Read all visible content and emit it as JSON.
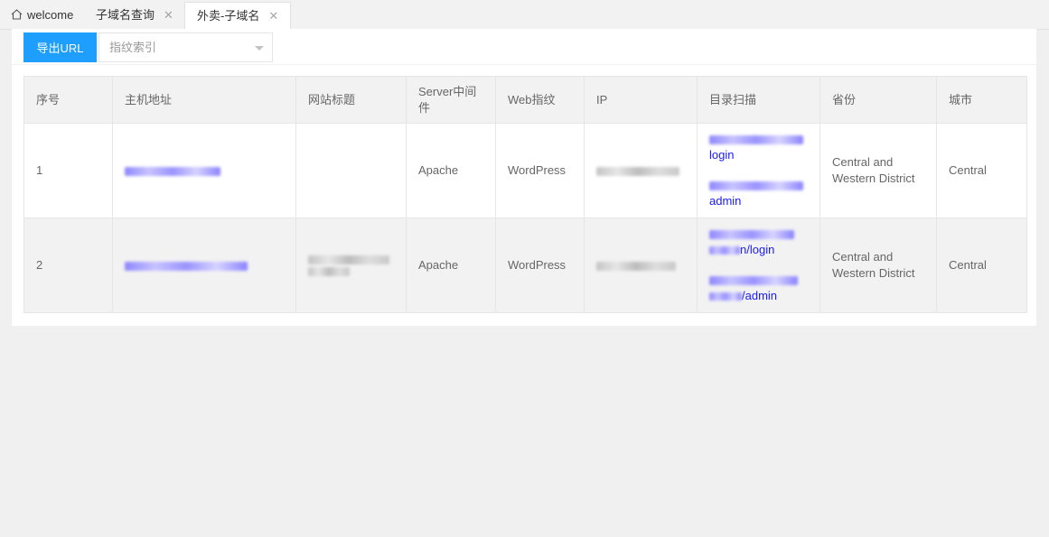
{
  "tabs": {
    "home_label": "welcome",
    "items": [
      {
        "label": "子域名查询",
        "close": "✕"
      },
      {
        "label": "外卖-子域名",
        "close": "✕"
      }
    ]
  },
  "toolbar": {
    "export_label": "导出URL",
    "select_placeholder": "指纹索引"
  },
  "table": {
    "headers": [
      "序号",
      "主机地址",
      "网站标题",
      "Server中间件",
      "Web指纹",
      "IP",
      "目录扫描",
      "省份",
      "城市"
    ],
    "rows": [
      {
        "index": "1",
        "server": "Apache",
        "fingerprint": "WordPress",
        "dir_links": [
          "login",
          "admin"
        ],
        "province": "Central and Western District",
        "city": "Central"
      },
      {
        "index": "2",
        "server": "Apache",
        "fingerprint": "WordPress",
        "dir_links": [
          "n/login",
          "/admin"
        ],
        "province": "Central and Western District",
        "city": "Central"
      }
    ]
  },
  "colors": {
    "accent": "#1e9fff",
    "link": "#1a1aff",
    "header_bg": "#f2f2f2"
  }
}
